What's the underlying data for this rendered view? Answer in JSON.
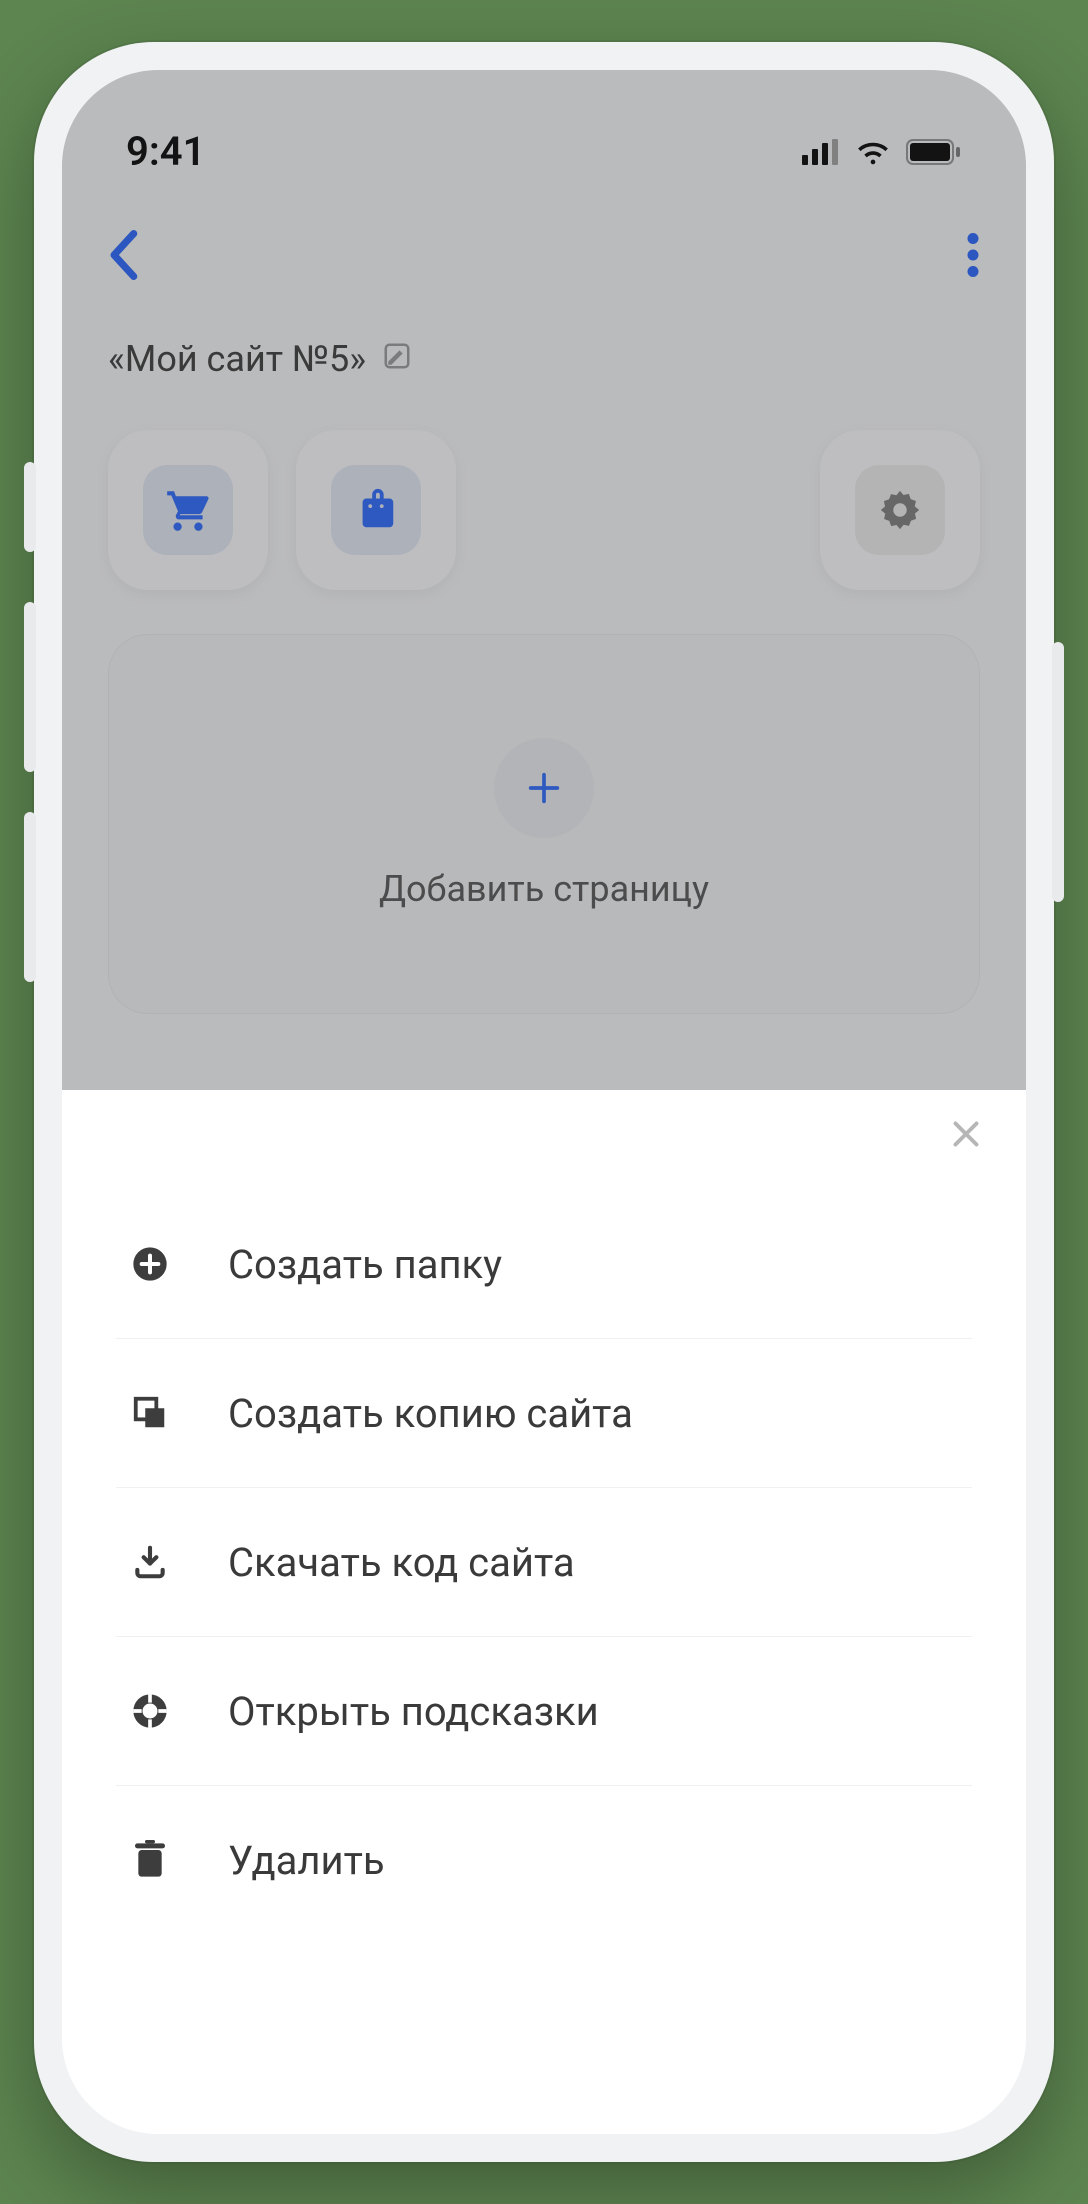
{
  "status": {
    "time": "9:41"
  },
  "page": {
    "title": "«Мой сайт №5»",
    "add_page_label": "Добавить страницу"
  },
  "sheet": {
    "items": [
      {
        "label": "Создать папку"
      },
      {
        "label": "Создать копию сайта"
      },
      {
        "label": "Скачать код сайта"
      },
      {
        "label": "Открыть подсказки"
      },
      {
        "label": "Удалить"
      }
    ]
  }
}
